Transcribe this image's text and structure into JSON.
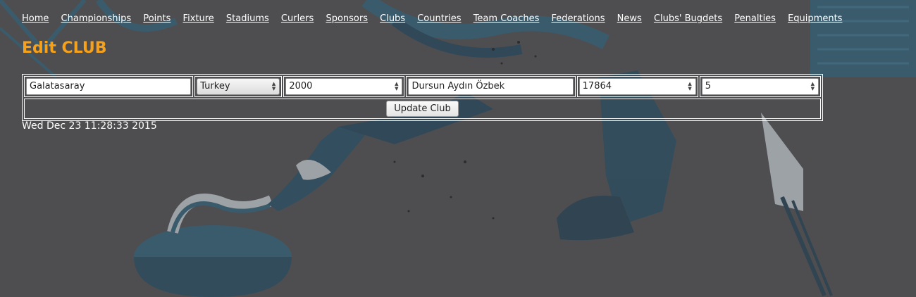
{
  "nav": {
    "items": [
      "Home",
      "Championships",
      "Points",
      "Fixture",
      "Stadiums",
      "Curlers",
      "Sponsors",
      "Clubs",
      "Countries",
      "Team Coaches",
      "Federations",
      "News",
      "Clubs' Bugdets",
      "Penalties",
      "Equipments"
    ]
  },
  "page": {
    "title": "Edit CLUB"
  },
  "form": {
    "club_name": "Galatasaray",
    "country": "Turkey",
    "year": "2000",
    "president": "Dursun Aydın Özbek",
    "number_value": "17864",
    "small_value": "5",
    "submit_label": "Update Club"
  },
  "footer": {
    "timestamp": "Wed Dec 23 11:28:33 2015"
  },
  "colors": {
    "background": "#4e4e50",
    "title": "#f5a11c",
    "art": "#1f4e6e"
  }
}
